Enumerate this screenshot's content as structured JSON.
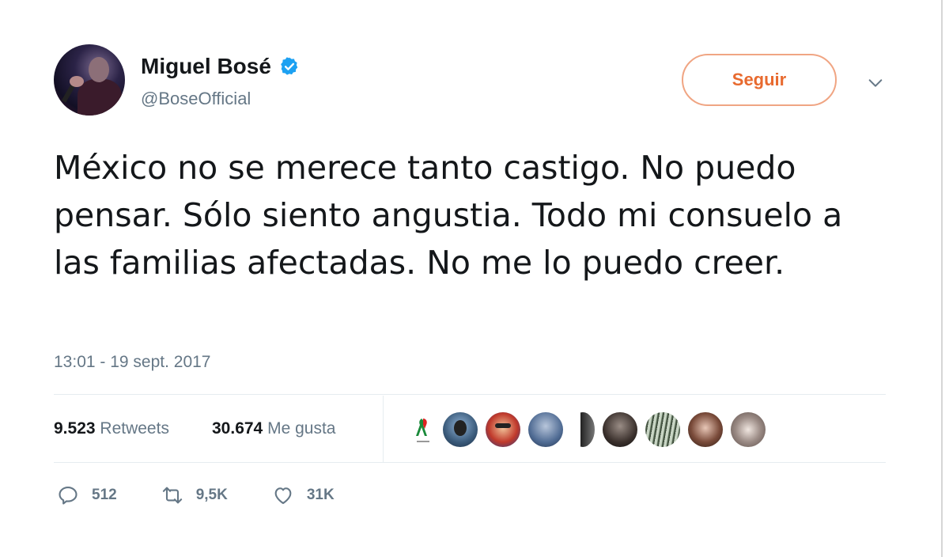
{
  "user": {
    "display_name": "Miguel Bosé",
    "handle": "@BoseOfficial",
    "verified_icon": "verified-badge-icon"
  },
  "follow_button": {
    "label": "Seguir"
  },
  "menu_icon": "chevron-down-icon",
  "tweet": {
    "text": "México no se merece tanto castigo. No puedo pensar. Sólo siento angustia. Todo mi consuelo a las familias afectadas. No me lo puedo creer.",
    "timestamp": "13:01 - 19 sept. 2017"
  },
  "stats": {
    "retweets_count": "9.523",
    "retweets_label": "Retweets",
    "likes_count": "30.674",
    "likes_label": "Me gusta"
  },
  "likers": [
    {
      "icon": "mexico-ribbon-icon"
    },
    {
      "icon": "avatar"
    },
    {
      "icon": "avatar"
    },
    {
      "icon": "avatar"
    },
    {
      "icon": "avatar"
    },
    {
      "icon": "avatar"
    },
    {
      "icon": "avatar"
    },
    {
      "icon": "avatar"
    },
    {
      "icon": "avatar"
    }
  ],
  "actions": {
    "reply_count": "512",
    "retweet_count": "9,5K",
    "like_count": "31K"
  },
  "colors": {
    "accent": "#e86a2f",
    "follow_border": "#f0a583",
    "verified": "#1da1f2",
    "muted": "#657786"
  }
}
